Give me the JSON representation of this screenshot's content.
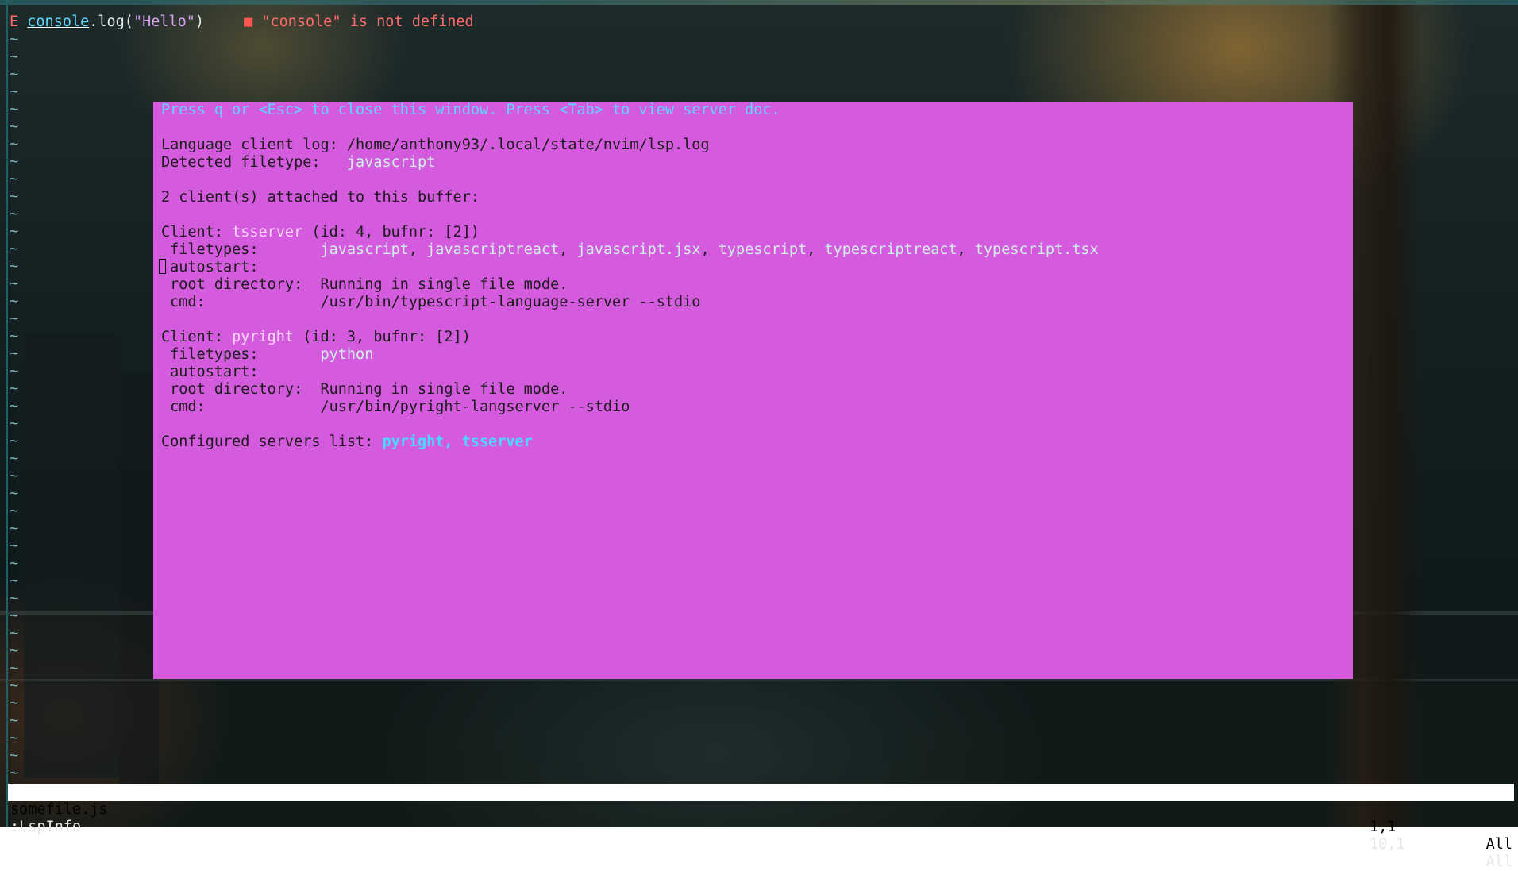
{
  "buffer": {
    "sign": "E",
    "code_keyword": "console",
    "code_method": ".log(",
    "code_string": "\"Hello\"",
    "code_close": ")",
    "diagnostic_marker": "■",
    "diagnostic_message": "\"console\" is not defined",
    "tilde": "~",
    "tilde_count": 43
  },
  "lspinfo": {
    "hint": "Press q or <Esc> to close this window. Press <Tab> to view server doc.",
    "log_label": "Language client log:",
    "log_path": "/home/anthony93/.local/state/nvim/lsp.log",
    "filetype_label": "Detected filetype:",
    "filetype_value": "javascript",
    "attached": "2 client(s) attached to this buffer:",
    "clients": [
      {
        "label": "Client:",
        "name": "tsserver",
        "meta": "(id: 4, bufnr: [2])",
        "filetypes_label": "filetypes:",
        "filetypes": [
          "javascript",
          "javascriptreact",
          "javascript.jsx",
          "typescript",
          "typescriptreact",
          "typescript.tsx"
        ],
        "autostart_label": "autostart:",
        "autostart_value": "",
        "root_label": "root directory:",
        "root_value": "Running in single file mode.",
        "cmd_label": "cmd:",
        "cmd_value": "/usr/bin/typescript-language-server --stdio"
      },
      {
        "label": "Client:",
        "name": "pyright",
        "meta": "(id: 3, bufnr: [2])",
        "filetypes_label": "filetypes:",
        "filetypes": [
          "python"
        ],
        "autostart_label": "autostart:",
        "autostart_value": "",
        "root_label": "root directory:",
        "root_value": "Running in single file mode.",
        "cmd_label": "cmd:",
        "cmd_value": "/usr/bin/pyright-langserver --stdio"
      }
    ],
    "configured_label": "Configured servers list:",
    "configured_value": "pyright, tsserver"
  },
  "statusline": {
    "filename": "somefile.js",
    "position": "1,1",
    "percent": "All"
  },
  "cmdline": {
    "command": ":LspInfo",
    "position": "10,1",
    "percent": "All"
  },
  "colors": {
    "float_bg": "#d45ade",
    "hint": "#5fd7ff",
    "error": "#ff6b6b",
    "tilde": "#7ab2b6"
  }
}
